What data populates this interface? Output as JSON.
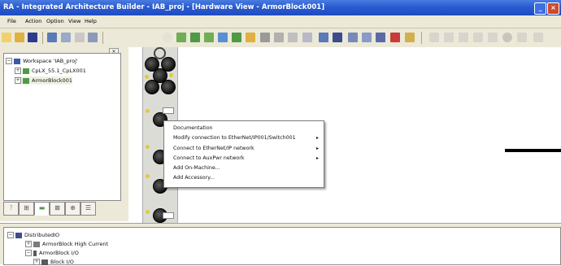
{
  "window": {
    "title": "RA - Integrated Architecture Builder - IAB_proj - [Hardware View - ArmorBlock001]"
  },
  "menubar": {
    "items": [
      "File",
      "Action",
      "Option",
      "View",
      "Help"
    ]
  },
  "workspace_tree": {
    "items": [
      {
        "label": "Workspace 'IAB_proj'",
        "level": 0,
        "expander": "−"
      },
      {
        "label": "CpLX_55.1_CpLX001",
        "level": 1,
        "expander": "+"
      },
      {
        "label": "ArmorBlock001",
        "level": 1,
        "expander": "+"
      }
    ]
  },
  "pane_close": "×",
  "context_menu": {
    "items": [
      {
        "label": "Documentation",
        "submenu": false
      },
      {
        "label": "Modify connection to EtherNet/IP001/Switch001",
        "submenu": true
      },
      {
        "label": "Connect to EtherNet/IP network",
        "submenu": true
      },
      {
        "label": "Connect to AuxPwr network",
        "submenu": true
      },
      {
        "label": "Add On-Machine...",
        "submenu": false
      },
      {
        "label": "Add Accessory...",
        "submenu": false
      }
    ],
    "arrow": "▸"
  },
  "bottom_tree": {
    "items": [
      {
        "label": "DistributedIO",
        "level": 0,
        "expander": "−"
      },
      {
        "label": "ArmorBlock High Current",
        "level": 1,
        "expander": "+"
      },
      {
        "label": "ArmorBlock I/O",
        "level": 1,
        "expander": "−"
      },
      {
        "label": "Block I/O",
        "level": 2,
        "expander": "+"
      }
    ]
  },
  "colors": {
    "titlebar": "#2a5bd0",
    "chrome": "#ece9d8",
    "connector": "#1a1a1a",
    "led": "#e6c640"
  }
}
